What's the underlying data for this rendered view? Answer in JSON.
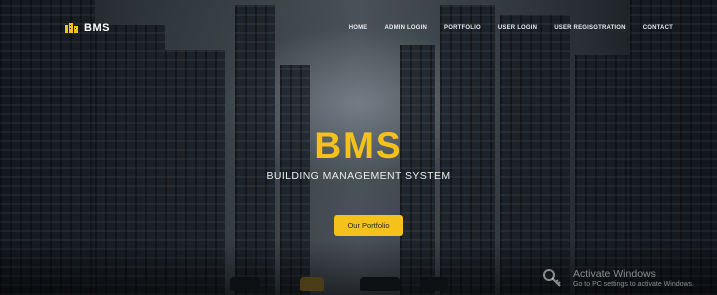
{
  "brand": {
    "name": "BMS",
    "icon": "building-logo-icon"
  },
  "nav": [
    {
      "label": "HOME"
    },
    {
      "label": "ADMIN LOGIN"
    },
    {
      "label": "PORTFOLIO"
    },
    {
      "label": "USER LOGIN"
    },
    {
      "label": "USER REGISGTRATION"
    },
    {
      "label": "CONTACT"
    }
  ],
  "hero": {
    "title": "BMS",
    "subtitle": "BUILDING MANAGEMENT SYSTEM",
    "button_label": "Our Portfolio"
  },
  "watermark": {
    "title": "Activate Windows",
    "subtitle": "Go to PC settings to activate Windows."
  },
  "colors": {
    "accent": "#f4c21a",
    "nav_text": "#e8eaec"
  }
}
